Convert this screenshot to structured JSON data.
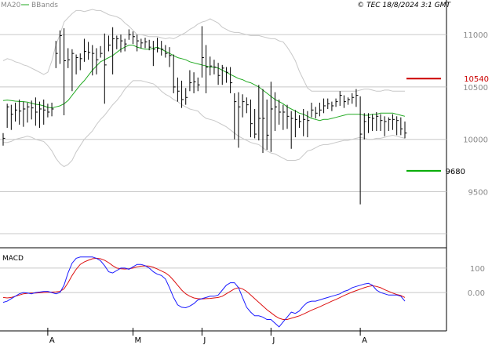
{
  "header": {
    "legend_ma": "MA20",
    "legend_bb": "BBands",
    "copyright": "© TEC 18/8/2024 3:1 GMT"
  },
  "macd_panel": {
    "label": "MACD",
    "tick_labels": [
      "100",
      "0.00"
    ]
  },
  "colors": {
    "price": "#000000",
    "ma20": "#22aa22",
    "bbands": "#c8c8c8",
    "macd": "#1a1aff",
    "signal": "#dd1111",
    "resistance": "#cc0000",
    "support": "#00aa00",
    "grid": "#c8c8c8",
    "axis": "#000000",
    "text": "#888888"
  },
  "chart_data": {
    "type": "line",
    "price_axis": {
      "ylim": [
        9100,
        11300
      ],
      "ticks": [
        9500,
        10000,
        10500,
        11000
      ],
      "tick_labels": [
        "9500",
        "10000",
        "10500",
        "11000"
      ]
    },
    "x_month_labels": [
      "A",
      "M",
      "J",
      "J",
      "A"
    ],
    "x_month_positions": [
      11,
      32,
      49,
      66,
      88
    ],
    "n_bars": 100,
    "price_bars": [
      {
        "h": 10060,
        "l": 9940,
        "c": 10010
      },
      {
        "h": 10340,
        "l": 10110,
        "c": 10310
      },
      {
        "h": 10330,
        "l": 10090,
        "c": 10240
      },
      {
        "h": 10350,
        "l": 10170,
        "c": 10280
      },
      {
        "h": 10380,
        "l": 10140,
        "c": 10270
      },
      {
        "h": 10360,
        "l": 10120,
        "c": 10290
      },
      {
        "h": 10350,
        "l": 10160,
        "c": 10310
      },
      {
        "h": 10370,
        "l": 10190,
        "c": 10300
      },
      {
        "h": 10400,
        "l": 10130,
        "c": 10260
      },
      {
        "h": 10360,
        "l": 10110,
        "c": 10290
      },
      {
        "h": 10380,
        "l": 10140,
        "c": 10280
      },
      {
        "h": 10340,
        "l": 10210,
        "c": 10260
      },
      {
        "h": 10350,
        "l": 10220,
        "c": 10290
      },
      {
        "h": 10940,
        "l": 10680,
        "c": 10820
      },
      {
        "h": 11040,
        "l": 10720,
        "c": 10990
      },
      {
        "h": 11060,
        "l": 10230,
        "c": 10750
      },
      {
        "h": 10870,
        "l": 10680,
        "c": 10760
      },
      {
        "h": 10860,
        "l": 10460,
        "c": 10820
      },
      {
        "h": 10810,
        "l": 10620,
        "c": 10780
      },
      {
        "h": 10820,
        "l": 10660,
        "c": 10770
      },
      {
        "h": 10960,
        "l": 10740,
        "c": 10840
      },
      {
        "h": 10930,
        "l": 10760,
        "c": 10830
      },
      {
        "h": 10900,
        "l": 10610,
        "c": 10820
      },
      {
        "h": 10870,
        "l": 10620,
        "c": 10760
      },
      {
        "h": 10890,
        "l": 10780,
        "c": 10820
      },
      {
        "h": 11010,
        "l": 10340,
        "c": 10710
      },
      {
        "h": 10990,
        "l": 10840,
        "c": 10900
      },
      {
        "h": 11070,
        "l": 10620,
        "c": 10960
      },
      {
        "h": 10990,
        "l": 10860,
        "c": 10960
      },
      {
        "h": 11000,
        "l": 10830,
        "c": 10940
      },
      {
        "h": 10960,
        "l": 10840,
        "c": 10910
      },
      {
        "h": 11050,
        "l": 10950,
        "c": 11000
      },
      {
        "h": 11030,
        "l": 10910,
        "c": 10980
      },
      {
        "h": 11000,
        "l": 10840,
        "c": 10940
      },
      {
        "h": 10960,
        "l": 10870,
        "c": 10920
      },
      {
        "h": 10970,
        "l": 10870,
        "c": 10930
      },
      {
        "h": 10950,
        "l": 10850,
        "c": 10880
      },
      {
        "h": 10940,
        "l": 10700,
        "c": 10860
      },
      {
        "h": 10970,
        "l": 10830,
        "c": 10870
      },
      {
        "h": 10940,
        "l": 10800,
        "c": 10860
      },
      {
        "h": 10900,
        "l": 10780,
        "c": 10820
      },
      {
        "h": 10880,
        "l": 10690,
        "c": 10800
      },
      {
        "h": 10810,
        "l": 10440,
        "c": 10500
      },
      {
        "h": 10590,
        "l": 10360,
        "c": 10460
      },
      {
        "h": 10560,
        "l": 10300,
        "c": 10380
      },
      {
        "h": 10490,
        "l": 10330,
        "c": 10400
      },
      {
        "h": 10660,
        "l": 10460,
        "c": 10540
      },
      {
        "h": 10640,
        "l": 10440,
        "c": 10550
      },
      {
        "h": 10590,
        "l": 10460,
        "c": 10520
      },
      {
        "h": 11080,
        "l": 10590,
        "c": 10780
      },
      {
        "h": 10900,
        "l": 10440,
        "c": 10690
      },
      {
        "h": 10790,
        "l": 10610,
        "c": 10700
      },
      {
        "h": 10760,
        "l": 10620,
        "c": 10690
      },
      {
        "h": 10730,
        "l": 10520,
        "c": 10610
      },
      {
        "h": 10710,
        "l": 10520,
        "c": 10680
      },
      {
        "h": 10690,
        "l": 10540,
        "c": 10640
      },
      {
        "h": 10690,
        "l": 10440,
        "c": 10540
      },
      {
        "h": 10440,
        "l": 10000,
        "c": 10360
      },
      {
        "h": 10450,
        "l": 9920,
        "c": 10310
      },
      {
        "h": 10430,
        "l": 10210,
        "c": 10360
      },
      {
        "h": 10400,
        "l": 10250,
        "c": 10330
      },
      {
        "h": 10380,
        "l": 10020,
        "c": 10150
      },
      {
        "h": 10290,
        "l": 10010,
        "c": 10050
      },
      {
        "h": 10520,
        "l": 9990,
        "c": 10200
      },
      {
        "h": 10480,
        "l": 9870,
        "c": 10200
      },
      {
        "h": 10380,
        "l": 9900,
        "c": 10040
      },
      {
        "h": 10550,
        "l": 9880,
        "c": 10290
      },
      {
        "h": 10450,
        "l": 10080,
        "c": 10310
      },
      {
        "h": 10380,
        "l": 10140,
        "c": 10260
      },
      {
        "h": 10330,
        "l": 10090,
        "c": 10260
      },
      {
        "h": 10330,
        "l": 10100,
        "c": 10220
      },
      {
        "h": 10270,
        "l": 9910,
        "c": 10200
      },
      {
        "h": 10280,
        "l": 10020,
        "c": 10190
      },
      {
        "h": 10230,
        "l": 10110,
        "c": 10170
      },
      {
        "h": 10290,
        "l": 10030,
        "c": 10190
      },
      {
        "h": 10270,
        "l": 10020,
        "c": 10180
      },
      {
        "h": 10350,
        "l": 10210,
        "c": 10280
      },
      {
        "h": 10310,
        "l": 10200,
        "c": 10250
      },
      {
        "h": 10350,
        "l": 10220,
        "c": 10280
      },
      {
        "h": 10390,
        "l": 10250,
        "c": 10320
      },
      {
        "h": 10390,
        "l": 10290,
        "c": 10340
      },
      {
        "h": 10360,
        "l": 10270,
        "c": 10320
      },
      {
        "h": 10390,
        "l": 10310,
        "c": 10360
      },
      {
        "h": 10460,
        "l": 10320,
        "c": 10420
      },
      {
        "h": 10420,
        "l": 10300,
        "c": 10360
      },
      {
        "h": 10400,
        "l": 10330,
        "c": 10380
      },
      {
        "h": 10440,
        "l": 10340,
        "c": 10400
      },
      {
        "h": 10480,
        "l": 10310,
        "c": 10420
      },
      {
        "h": 10410,
        "l": 9380,
        "c": 10050
      },
      {
        "h": 10250,
        "l": 10000,
        "c": 10170
      },
      {
        "h": 10250,
        "l": 10060,
        "c": 10210
      },
      {
        "h": 10240,
        "l": 10080,
        "c": 10200
      },
      {
        "h": 10260,
        "l": 10080,
        "c": 10220
      },
      {
        "h": 10240,
        "l": 10080,
        "c": 10180
      },
      {
        "h": 10220,
        "l": 10030,
        "c": 10170
      },
      {
        "h": 10210,
        "l": 10080,
        "c": 10190
      },
      {
        "h": 10240,
        "l": 10090,
        "c": 10190
      },
      {
        "h": 10220,
        "l": 10040,
        "c": 10180
      },
      {
        "h": 10210,
        "l": 10040,
        "c": 10100
      },
      {
        "h": 10170,
        "l": 10010,
        "c": 10060
      }
    ],
    "ma20": [
      10370,
      10375,
      10370,
      10365,
      10362,
      10360,
      10355,
      10345,
      10335,
      10330,
      10320,
      10305,
      10300,
      10310,
      10320,
      10340,
      10370,
      10420,
      10470,
      10520,
      10560,
      10610,
      10660,
      10700,
      10740,
      10760,
      10780,
      10800,
      10830,
      10860,
      10880,
      10900,
      10900,
      10880,
      10870,
      10860,
      10860,
      10870,
      10880,
      10860,
      10840,
      10820,
      10800,
      10780,
      10770,
      10760,
      10740,
      10730,
      10720,
      10710,
      10700,
      10690,
      10690,
      10680,
      10660,
      10640,
      10620,
      10600,
      10580,
      10570,
      10550,
      10540,
      10520,
      10500,
      10470,
      10440,
      10410,
      10380,
      10360,
      10340,
      10310,
      10290,
      10270,
      10250,
      10240,
      10220,
      10200,
      10190,
      10180,
      10190,
      10190,
      10200,
      10210,
      10220,
      10230,
      10240,
      10240,
      10240,
      10240,
      10230,
      10230,
      10240,
      10240,
      10250,
      10250,
      10250,
      10250,
      10240,
      10230,
      10220
    ],
    "bb_upper": [
      10750,
      10770,
      10760,
      10740,
      10730,
      10710,
      10700,
      10680,
      10660,
      10640,
      10620,
      10640,
      10750,
      10900,
      11000,
      11120,
      11160,
      11200,
      11230,
      11230,
      11220,
      11230,
      11240,
      11230,
      11230,
      11210,
      11190,
      11180,
      11170,
      11150,
      11110,
      11080,
      11040,
      11000,
      11000,
      10990,
      10980,
      10980,
      10980,
      10970,
      10960,
      10970,
      10960,
      10980,
      11000,
      11020,
      11050,
      11070,
      11100,
      11120,
      11130,
      11150,
      11130,
      11110,
      11070,
      11050,
      11030,
      11020,
      11020,
      11010,
      11000,
      10990,
      10990,
      10990,
      10980,
      10970,
      10960,
      10960,
      10940,
      10930,
      10880,
      10820,
      10750,
      10650,
      10570,
      10490,
      10460,
      10460,
      10460,
      10460,
      10460,
      10460,
      10460,
      10460,
      10460,
      10460,
      10460,
      10460,
      10470,
      10480,
      10480,
      10470,
      10460,
      10460,
      10470,
      10470,
      10460,
      10460,
      10460,
      10460
    ],
    "bb_lower": [
      9970,
      9970,
      9980,
      10000,
      10010,
      10020,
      10030,
      10020,
      10000,
      9990,
      9980,
      9940,
      9890,
      9820,
      9770,
      9740,
      9760,
      9800,
      9880,
      9940,
      10000,
      10040,
      10080,
      10140,
      10190,
      10230,
      10280,
      10330,
      10370,
      10420,
      10480,
      10520,
      10560,
      10560,
      10560,
      10550,
      10540,
      10530,
      10500,
      10460,
      10430,
      10410,
      10380,
      10360,
      10330,
      10310,
      10290,
      10280,
      10270,
      10230,
      10200,
      10190,
      10180,
      10160,
      10140,
      10120,
      10090,
      10060,
      10030,
      10010,
      9990,
      9970,
      9960,
      9950,
      9920,
      9890,
      9870,
      9860,
      9840,
      9820,
      9800,
      9800,
      9800,
      9810,
      9850,
      9890,
      9900,
      9920,
      9940,
      9950,
      9950,
      9960,
      9970,
      9980,
      9990,
      9990,
      10000,
      10010,
      10020,
      10010,
      10000,
      10000,
      10010,
      10010,
      10020,
      10030,
      10040,
      10030,
      10020,
      10010
    ],
    "macd_axis": {
      "ylim": [
        -150,
        170
      ],
      "ticks": [
        100,
        0
      ]
    },
    "macd": [
      -40,
      -35,
      -25,
      -15,
      -5,
      0,
      -2,
      -5,
      0,
      2,
      5,
      5,
      0,
      -5,
      0,
      30,
      80,
      120,
      140,
      145,
      145,
      145,
      145,
      140,
      130,
      110,
      85,
      80,
      90,
      100,
      100,
      95,
      105,
      115,
      115,
      110,
      100,
      85,
      75,
      70,
      55,
      20,
      -20,
      -50,
      -60,
      -62,
      -55,
      -45,
      -30,
      -25,
      -20,
      -15,
      -15,
      -10,
      10,
      30,
      40,
      40,
      20,
      -20,
      -60,
      -80,
      -95,
      -95,
      -100,
      -110,
      -110,
      -125,
      -140,
      -120,
      -100,
      -80,
      -85,
      -75,
      -55,
      -40,
      -35,
      -35,
      -30,
      -25,
      -20,
      -15,
      -10,
      -5,
      5,
      10,
      20,
      25,
      30,
      35,
      38,
      30,
      10,
      0,
      -5,
      -10,
      -10,
      -10,
      -15,
      -35
    ],
    "signal": [
      -20,
      -22,
      -20,
      -15,
      -10,
      -5,
      -3,
      -2,
      -2,
      -1,
      0,
      1,
      2,
      3,
      5,
      15,
      40,
      70,
      95,
      115,
      125,
      132,
      138,
      140,
      138,
      132,
      122,
      110,
      100,
      97,
      96,
      97,
      100,
      105,
      108,
      109,
      108,
      103,
      96,
      88,
      80,
      68,
      50,
      30,
      10,
      -5,
      -15,
      -22,
      -25,
      -26,
      -25,
      -24,
      -22,
      -20,
      -15,
      -5,
      5,
      15,
      20,
      15,
      5,
      -10,
      -25,
      -40,
      -55,
      -70,
      -82,
      -95,
      -105,
      -110,
      -110,
      -105,
      -100,
      -95,
      -88,
      -80,
      -72,
      -65,
      -58,
      -50,
      -43,
      -35,
      -28,
      -20,
      -12,
      -5,
      2,
      8,
      14,
      20,
      25,
      28,
      25,
      20,
      12,
      5,
      -2,
      -8,
      -12,
      -20
    ],
    "resistance": {
      "value": 10580,
      "label": "10540"
    },
    "support": {
      "value": 9700,
      "label": "9680"
    }
  }
}
